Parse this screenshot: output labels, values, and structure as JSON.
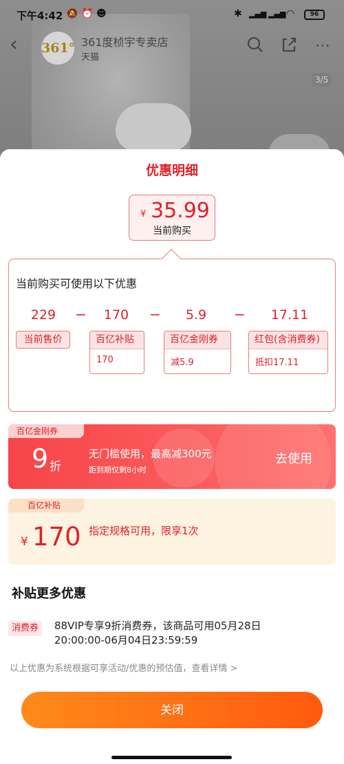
{
  "status_bar": {
    "time": "下午4:42",
    "battery": "96",
    "icons": [
      "mute-icon",
      "alarm-icon",
      "app-icon",
      "bluetooth-icon",
      "hd-signal-icon",
      "signal-icon",
      "wifi-icon"
    ]
  },
  "app_bar": {
    "logo_text": "361°",
    "shop_name": "361度桢宇专卖店",
    "shop_platform": "天猫",
    "icons": [
      "back-icon",
      "search-icon",
      "share-icon",
      "more-icon"
    ]
  },
  "image_counter": "3/5",
  "sheet": {
    "title": "优惠明细",
    "price": {
      "currency": "¥",
      "amount": "35.99",
      "label": "当前购买"
    },
    "calc": {
      "title": "当前购买可使用以下优惠",
      "numbers": [
        "229",
        "170",
        "5.9",
        "17.11"
      ],
      "operator": "−",
      "tag_current_price": "当前售价",
      "cards": [
        {
          "head": "百亿补贴",
          "body": "170"
        },
        {
          "head": "百亿金刚券",
          "body": "减5.9"
        },
        {
          "head": "红包(含消费券)",
          "body": "抵扣17.11"
        }
      ]
    },
    "coupon": {
      "badge": "百亿金刚券",
      "discount": "9",
      "unit": "折",
      "desc": "无门槛使用，最高减300元",
      "note": "距到期仅剩8小时",
      "action": "去使用"
    },
    "subsidy": {
      "badge": "百亿补贴",
      "currency": "¥",
      "amount": "170",
      "desc": "指定规格可用，限享1次"
    },
    "more": {
      "title": "补贴更多优惠",
      "tag": "消费券",
      "text": "88VIP专享9折消费券，该商品可用05月28日20:00:00-06月04日23:59:59"
    },
    "disclaimer": "以上优惠为系统根据可享活动/优惠的预估值，查看详情 >",
    "close_label": "关闭"
  },
  "colors": {
    "accent_red": "#e0202a",
    "coupon_red": "#f74449",
    "button_orange": "#ff6a12",
    "subsidy_bg": "#fdf3e1"
  }
}
